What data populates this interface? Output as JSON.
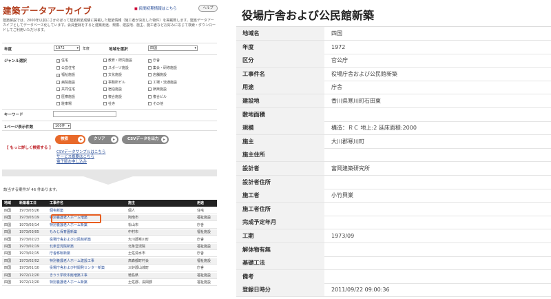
{
  "left": {
    "title": "建築データアーカイブ",
    "header_link": "民間初期情報はこちら",
    "help_label": "ヘルプ",
    "intro": "建築解説では、2000年以前にさかのぼって建築新築成績に掲載した建築情報（施工者が決定した物件）を掲載致します。建築データアーカイブとしてデータベース化しています。会員登録をすると建築用途、規模、建設地、施主、施工者などお好みに応じて検索・ダウンロードしてご利用いただけます。",
    "form": {
      "year_label": "年度",
      "year_value": "1972",
      "year_suffix": "年度",
      "region_label": "地域を選択",
      "region_value": "四国",
      "genre_label": "ジャンル選択",
      "genres": [
        {
          "label": "住宅",
          "checked": true
        },
        {
          "label": "公営住宅",
          "checked": false
        },
        {
          "label": "福祉施設",
          "checked": true
        },
        {
          "label": "病院施設",
          "checked": false
        },
        {
          "label": "共同住宅",
          "checked": false
        },
        {
          "label": "医療施設",
          "checked": false
        },
        {
          "label": "駐車場",
          "checked": false
        },
        {
          "label": "教育・研究施設",
          "checked": false
        },
        {
          "label": "スポーツ施設",
          "checked": false
        },
        {
          "label": "文化施設",
          "checked": false
        },
        {
          "label": "事務所ビル",
          "checked": false
        },
        {
          "label": "宿泊施設",
          "checked": false
        },
        {
          "label": "複合施設",
          "checked": false
        },
        {
          "label": "社寺",
          "checked": false
        },
        {
          "label": "庁舎",
          "checked": true
        },
        {
          "label": "集会・研修施設",
          "checked": false
        },
        {
          "label": "店舗施設",
          "checked": false
        },
        {
          "label": "工場・流通施設",
          "checked": false
        },
        {
          "label": "娯楽施設",
          "checked": false
        },
        {
          "label": "複合ビル",
          "checked": false
        },
        {
          "label": "その他",
          "checked": false
        }
      ],
      "keyword_label": "キーワード",
      "perpage_label": "1ページ表示件数",
      "perpage_value": "100件",
      "search_btn": "検索",
      "clear_btn": "クリア",
      "csv_btn": "CSVデータを出力"
    },
    "more_search": "【 もっと詳しく検索する 】",
    "links": [
      "CSVデータサンプルはこちら",
      "サービス概要はこちら",
      "電子版お申し込み"
    ],
    "result_count": "該当する案件が 46 件あります。",
    "table": {
      "headers": [
        "地域",
        "新築着工日",
        "工事件名",
        "施主",
        "用途"
      ],
      "rows": [
        [
          "四国",
          "1973/03/26",
          "個宅新築",
          "個人",
          "住宅"
        ],
        [
          "四国",
          "1973/03/19",
          "特別養護老人ホーム増築",
          "阿南市",
          "福祉施設"
        ],
        [
          "四国",
          "1973/03/14",
          "特別養護老人ホーム新築",
          "松山市",
          "庁舎"
        ],
        [
          "四国",
          "1973/03/05",
          "もみじ保育園新築",
          "中村市",
          "福祉施設"
        ],
        [
          "四国",
          "1973/02/23",
          "役場庁舎および公民館新築",
          "大川郡寒川町",
          "庁舎"
        ],
        [
          "四国",
          "1973/02/19",
          "北条営児院新築",
          "北条営児院",
          "福祉施設"
        ],
        [
          "四国",
          "1973/02/15",
          "庁舎移転新築",
          "土佐清水市",
          "庁舎"
        ],
        [
          "四国",
          "1973/02/02",
          "特別養護老人ホーム建設工事",
          "高森都町村会",
          "福祉施設"
        ],
        [
          "四国",
          "1973/01/10",
          "役場庁舎および村開発センター新築",
          "三好郡山城町",
          "庁舎"
        ],
        [
          "四国",
          "1972/12/20",
          "きうう学校本館増築工事",
          "徳島県",
          "福祉施設"
        ],
        [
          "四国",
          "1972/12/20",
          "特別養護老人ホーム新築",
          "土佐郡、長岡郡",
          "福祉施設"
        ]
      ]
    }
  },
  "right": {
    "title": "役場庁舎および公民館新築",
    "fields": [
      {
        "key": "地域名",
        "value": "四国"
      },
      {
        "key": "年度",
        "value": "1972"
      },
      {
        "key": "区分",
        "value": "官公庁"
      },
      {
        "key": "工事件名",
        "value": "役場庁舎および公民館新築"
      },
      {
        "key": "用途",
        "value": "庁舎"
      },
      {
        "key": "建設地",
        "value": "香川県寒川町石田東"
      },
      {
        "key": "敷地面積",
        "value": ""
      },
      {
        "key": "規模",
        "value": "構造：ＲＣ 地上:2 延床面積:2000"
      },
      {
        "key": "施主",
        "value": "大川郡寒川町"
      },
      {
        "key": "施主住所",
        "value": ""
      },
      {
        "key": "設計者",
        "value": "富岡建築研究所"
      },
      {
        "key": "設計者住所",
        "value": ""
      },
      {
        "key": "施工者",
        "value": "小竹興業"
      },
      {
        "key": "施工者住所",
        "value": ""
      },
      {
        "key": "完成予定年月",
        "value": ""
      },
      {
        "key": "工期",
        "value": "1973/09"
      },
      {
        "key": "解体物有無",
        "value": ""
      },
      {
        "key": "基礎工法",
        "value": ""
      },
      {
        "key": "備考",
        "value": ""
      },
      {
        "key": "登録日時分",
        "value": "2011/09/22 09:00:36"
      }
    ]
  },
  "colors": {
    "title_brown": "#b13a19",
    "accent_orange": "#e8692a",
    "highlight_box": "#e85d1f",
    "link_blue": "#2a4f9a"
  }
}
